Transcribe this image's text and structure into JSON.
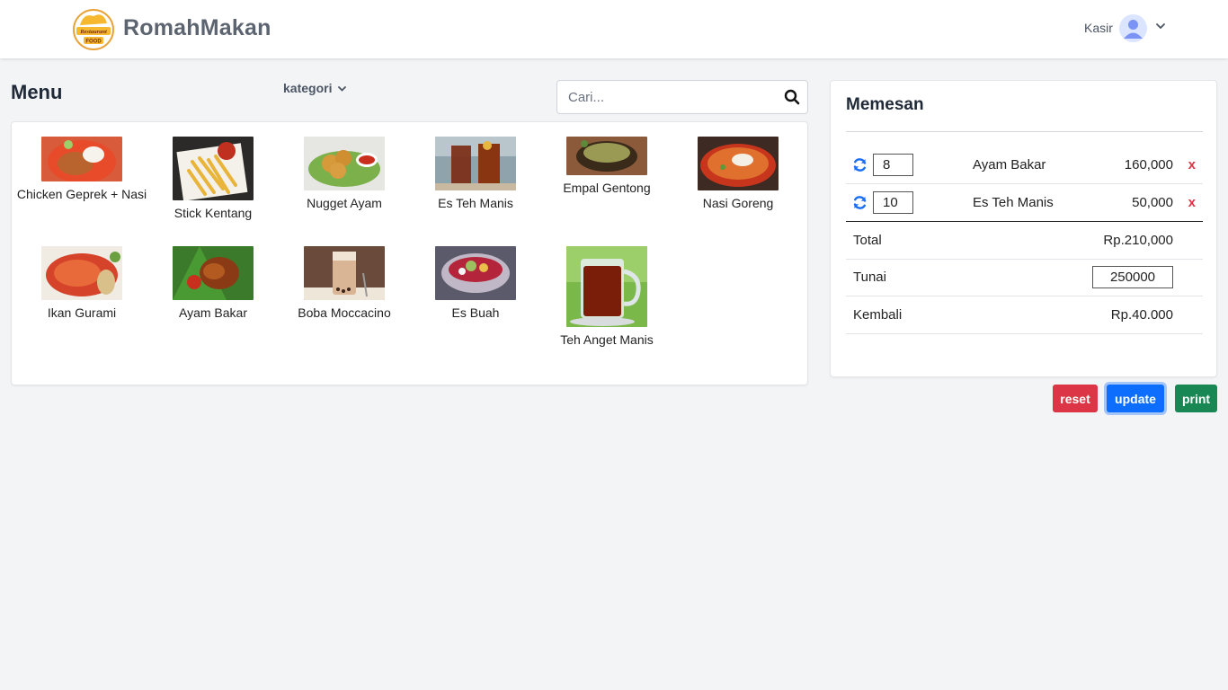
{
  "brand": {
    "name": "RomahMakan",
    "logo_text": [
      "Restaurant",
      "FOOD"
    ]
  },
  "user": {
    "role": "Kasir"
  },
  "menu": {
    "title": "Menu",
    "category_label": "kategori",
    "search_placeholder": "Cari...",
    "items": [
      {
        "name": "Chicken Geprek + Nasi"
      },
      {
        "name": "Stick Kentang"
      },
      {
        "name": "Nugget Ayam"
      },
      {
        "name": "Es Teh Manis"
      },
      {
        "name": "Empal Gentong"
      },
      {
        "name": "Nasi Goreng"
      },
      {
        "name": "Ikan Gurami"
      },
      {
        "name": "Ayam Bakar"
      },
      {
        "name": "Boba Moccacino"
      },
      {
        "name": "Es Buah"
      },
      {
        "name": "Teh Anget Manis"
      }
    ]
  },
  "order": {
    "title": "Memesan",
    "items": [
      {
        "qty": "8",
        "name": "Ayam Bakar",
        "price": "160,000",
        "remove": "x"
      },
      {
        "qty": "10",
        "name": "Es Teh Manis",
        "price": "50,000",
        "remove": "x"
      }
    ],
    "total_label": "Total",
    "total_value": "Rp.210,000",
    "cash_label": "Tunai",
    "cash_value": "250000",
    "change_label": "Kembali",
    "change_value": "Rp.40.000"
  },
  "actions": {
    "reset": "reset",
    "update": "update",
    "print": "print"
  },
  "colors": {
    "danger": "#dc3545",
    "primary": "#0d6efd",
    "success": "#198754",
    "brand_text": "#5c6470"
  }
}
